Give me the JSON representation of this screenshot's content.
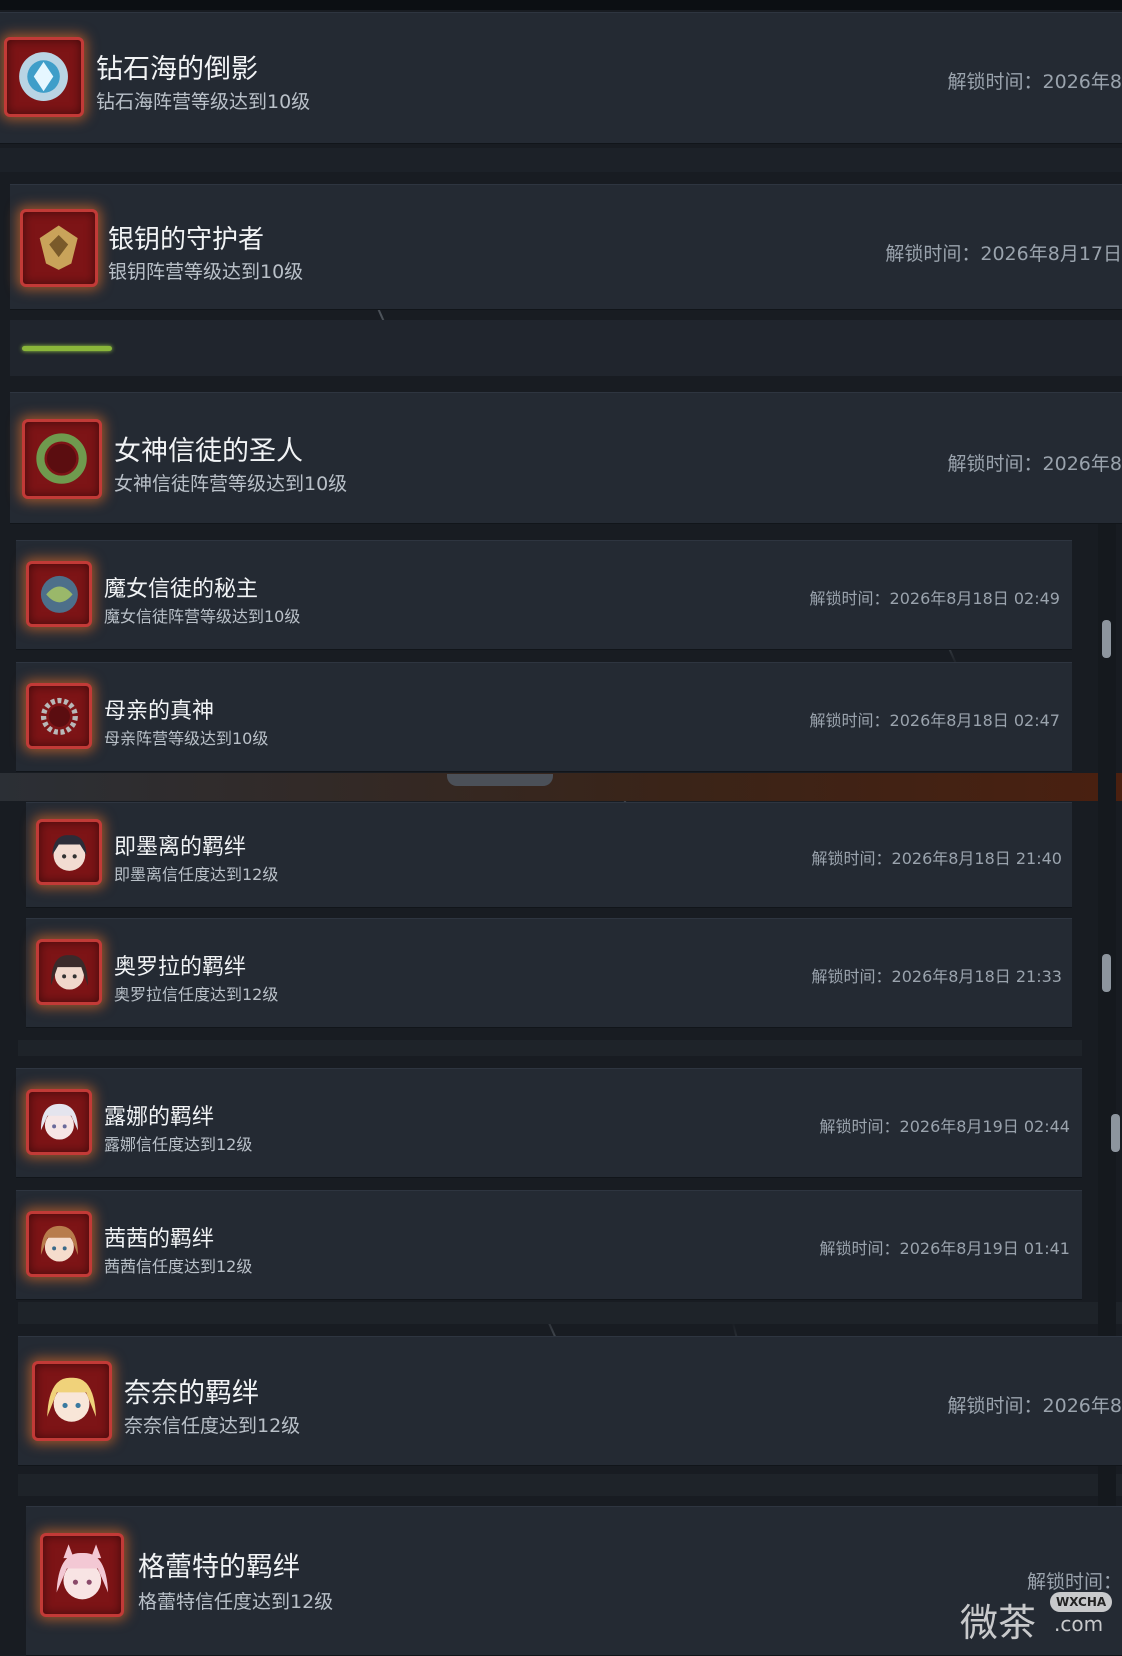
{
  "achievements": [
    {
      "title": "钻石海的倒影",
      "desc": "钻石海阵营等级达到10级",
      "time": "解锁时间：2026年8"
    },
    {
      "title": "银钥的守护者",
      "desc": "银钥阵营等级达到10级",
      "time": "解锁时间：2026年8月17日"
    },
    {
      "title": "女神信徒的圣人",
      "desc": "女神信徒阵营等级达到10级",
      "time": "解锁时间：2026年8"
    },
    {
      "title": "魔女信徒的秘主",
      "desc": "魔女信徒阵营等级达到10级",
      "time": "解锁时间：2026年8月18日 02:49"
    },
    {
      "title": "母亲的真神",
      "desc": "母亲阵营等级达到10级",
      "time": "解锁时间：2026年8月18日 02:47"
    },
    {
      "title": "即墨离的羁绊",
      "desc": "即墨离信任度达到12级",
      "time": "解锁时间：2026年8月18日 21:40"
    },
    {
      "title": "奥罗拉的羁绊",
      "desc": "奥罗拉信任度达到12级",
      "time": "解锁时间：2026年8月18日 21:33"
    },
    {
      "title": "露娜的羁绊",
      "desc": "露娜信任度达到12级",
      "time": "解锁时间：2026年8月19日 02:44"
    },
    {
      "title": "茜茜的羁绊",
      "desc": "茜茜信任度达到12级",
      "time": "解锁时间：2026年8月19日 01:41"
    },
    {
      "title": "奈奈的羁绊",
      "desc": "奈奈信任度达到12级",
      "time": "解锁时间：2026年8"
    },
    {
      "title": "格蕾特的羁绊",
      "desc": "格蕾特信任度达到12级",
      "time": "解锁时间："
    }
  ],
  "icons": [
    "diamond-crest-icon",
    "golden-wolf-crest-icon",
    "laurel-wreath-icon",
    "blue-globe-icon",
    "thorn-wreath-icon",
    "dark-haired-girl-avatar-icon",
    "dark-haired-woman-avatar-icon",
    "white-haired-girl-avatar-icon",
    "brown-haired-girl-avatar-icon",
    "blonde-girl-avatar-icon",
    "pink-haired-girl-avatar-icon"
  ],
  "watermark": {
    "cn": "微茶",
    "en": "WXCHA",
    "dotcom": ".com"
  },
  "colors": {
    "background": "#181c22",
    "card": "#242a33",
    "badge_frame": "#c23a37",
    "badge_glow": "#ff7828",
    "time_text": "#9aa3ad"
  }
}
